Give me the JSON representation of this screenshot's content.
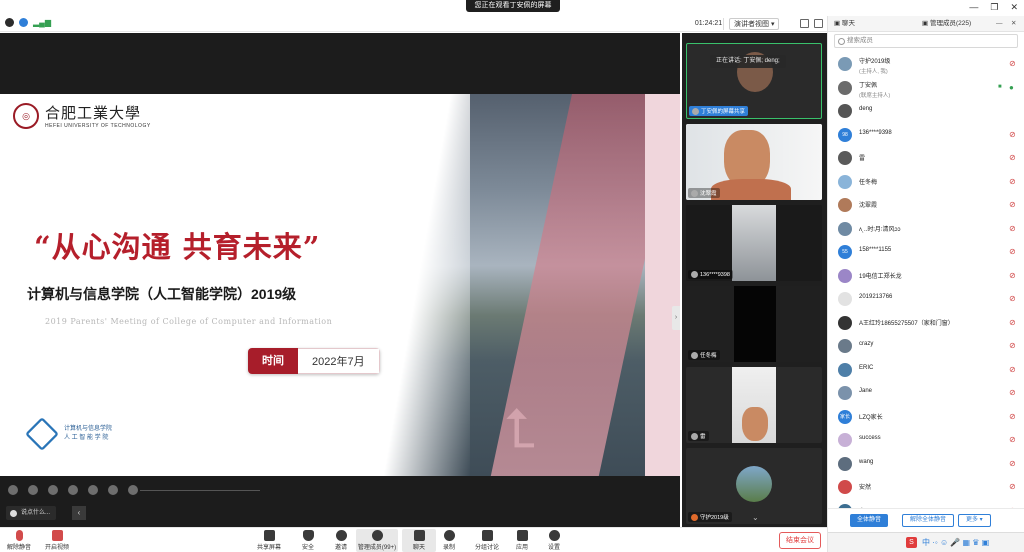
{
  "banner": {
    "text": "您正在观看丁安佩的屏幕"
  },
  "toolbar": {
    "timer": "01:24:21",
    "view_mode": "演讲者视图",
    "icons": [
      "info-icon",
      "shield-icon",
      "signal-icon"
    ]
  },
  "slide": {
    "logo_cn": "合肥工業大學",
    "logo_en": "HEFEI UNIVERSITY OF TECHNOLOGY",
    "title": "“从心沟通 共育未来”",
    "subtitle": "计算机与信息学院（人工智能学院）2019级",
    "subtitle_en": "2019 Parents' Meeting of College of Computer and Information",
    "time_label": "时间",
    "time_value": "2022年7月",
    "college_line1": "计算机与信息学院",
    "college_line2": "人 工 智 能 学 院"
  },
  "chat_input": {
    "placeholder": "说点什么..."
  },
  "video_strip": {
    "speaking": "正在讲话: 丁安佩; deng;",
    "tiles": [
      {
        "label": "丁安佩的屏幕共享"
      },
      {
        "label": "沈翠霞"
      },
      {
        "label": "136****9398"
      },
      {
        "label": "任冬梅"
      },
      {
        "label": "雷"
      },
      {
        "label": "守护2019级"
      }
    ]
  },
  "right_panel": {
    "tab_chat": "聊天",
    "tab_members": "管理成员(225)",
    "search_placeholder": "搜索成员",
    "members": [
      {
        "name": "守护2019级",
        "role": "(主持人, 我)",
        "avatar_color": "#7a9ab5",
        "avatar_text": "",
        "mic": "muted"
      },
      {
        "name": "丁安佩",
        "role": "(联席主持人)",
        "avatar_color": "#6b6b6b",
        "avatar_text": "",
        "mic": "on"
      },
      {
        "name": "deng",
        "role": "",
        "avatar_color": "#555555",
        "avatar_text": "",
        "mic": "none"
      },
      {
        "name": "136****9398",
        "role": "",
        "avatar_color": "#2f7fd8",
        "avatar_text": "98",
        "mic": "muted"
      },
      {
        "name": "雷",
        "role": "",
        "avatar_color": "#5a5a5a",
        "avatar_text": "",
        "mic": "muted"
      },
      {
        "name": "任冬梅",
        "role": "",
        "avatar_color": "#8ab4d9",
        "avatar_text": "",
        "mic": "muted"
      },
      {
        "name": "沈翠霞",
        "role": "",
        "avatar_color": "#b07a5a",
        "avatar_text": "",
        "mic": "muted"
      },
      {
        "name": "ʌ˛..时∶月∶清风ɔɔ",
        "role": "",
        "avatar_color": "#6f8aa3",
        "avatar_text": "",
        "mic": "muted"
      },
      {
        "name": "158****1155",
        "role": "",
        "avatar_color": "#2f7fd8",
        "avatar_text": "55",
        "mic": "muted"
      },
      {
        "name": "19电信工郑长龙",
        "role": "",
        "avatar_color": "#9b86c7",
        "avatar_text": "",
        "mic": "muted"
      },
      {
        "name": "2019213766",
        "role": "",
        "avatar_color": "#e2e2e2",
        "avatar_text": "",
        "mic": "muted"
      },
      {
        "name": "A王红玲18655275507（家和门窗）",
        "role": "",
        "avatar_color": "#333333",
        "avatar_text": "",
        "mic": "muted"
      },
      {
        "name": "crazy",
        "role": "",
        "avatar_color": "#6a7a8a",
        "avatar_text": "",
        "mic": "muted"
      },
      {
        "name": "ERIC",
        "role": "",
        "avatar_color": "#4e7fa8",
        "avatar_text": "",
        "mic": "muted"
      },
      {
        "name": "Jane",
        "role": "",
        "avatar_color": "#7b92ab",
        "avatar_text": "",
        "mic": "muted"
      },
      {
        "name": "LZQ家长",
        "role": "",
        "avatar_color": "#2f7fd8",
        "avatar_text": "家长",
        "mic": "muted"
      },
      {
        "name": "success",
        "role": "",
        "avatar_color": "#c7b0d6",
        "avatar_text": "",
        "mic": "muted"
      },
      {
        "name": "wang",
        "role": "",
        "avatar_color": "#5d6d7e",
        "avatar_text": "",
        "mic": "muted"
      },
      {
        "name": "安然",
        "role": "",
        "avatar_color": "#d04a4a",
        "avatar_text": "",
        "mic": "muted"
      },
      {
        "name": "白沙",
        "role": "",
        "avatar_color": "#3c6e91",
        "avatar_text": "",
        "mic": "muted"
      }
    ],
    "btn_mute_all": "全体静音",
    "btn_unmute_all": "解除全体静音",
    "btn_more": "更多"
  },
  "controls": {
    "unmute": "解除静音",
    "start_video": "开启视频",
    "share_screen": "共享屏幕",
    "security": "安全",
    "invite": "邀请",
    "manage_members": "管理成员(99+)",
    "chat": "聊天",
    "record": "录制",
    "breakout": "分组讨论",
    "apps": "应用",
    "settings": "设置",
    "end_meeting": "结束会议"
  },
  "colors": {
    "accent_red": "#b51f2b",
    "accent_blue": "#2f7fd8",
    "muted_red": "#d24b4b",
    "on_green": "#35a052"
  }
}
